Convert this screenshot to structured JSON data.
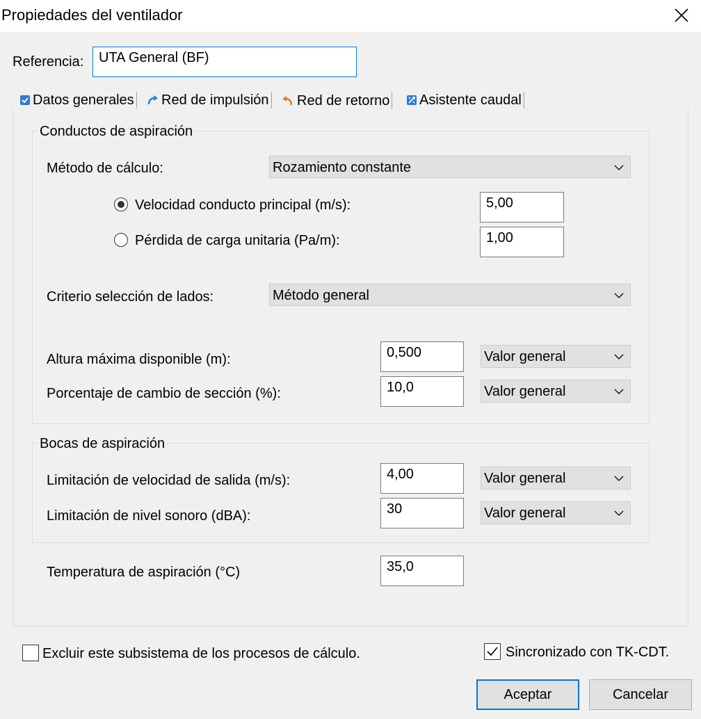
{
  "window": {
    "title": "Propiedades del ventilador",
    "close_icon": "close-icon"
  },
  "reference": {
    "label": "Referencia:",
    "value": "UTA General (BF)"
  },
  "tabs": [
    {
      "label": "Datos generales",
      "icon": "checkbox-icon"
    },
    {
      "label": "Red de impulsión",
      "icon": "arrow-forward-icon"
    },
    {
      "label": "Red de retorno",
      "icon": "arrow-return-icon"
    },
    {
      "label": "Asistente caudal",
      "icon": "wizard-icon"
    }
  ],
  "conductos": {
    "title": "Conductos de aspiración",
    "method_label": "Método de cálculo:",
    "method_value": "Rozamiento constante",
    "velocity_label": "Velocidad conducto principal (m/s):",
    "velocity_value": "5,00",
    "loss_label": "Pérdida de carga unitaria (Pa/m):",
    "loss_value": "1,00",
    "criterio_label": "Criterio selección de lados:",
    "criterio_value": "Método general",
    "altura_label": "Altura máxima disponible (m):",
    "altura_value": "0,500",
    "altura_mode": "Valor general",
    "porcentaje_label": "Porcentaje de cambio de sección (%):",
    "porcentaje_value": "10,0",
    "porcentaje_mode": "Valor general"
  },
  "bocas": {
    "title": "Bocas de aspiración",
    "velocidad_label": "Limitación de velocidad de salida (m/s):",
    "velocidad_value": "4,00",
    "velocidad_mode": "Valor general",
    "nivel_label": "Limitación de nivel sonoro (dBA):",
    "nivel_value": "30",
    "nivel_mode": "Valor general"
  },
  "temperatura": {
    "label": "Temperatura de aspiración (°C)",
    "value": "35,0"
  },
  "footer": {
    "excluir_label": "Excluir este subsistema de los procesos de cálculo.",
    "excluir_checked": false,
    "sincronizado_label": "Sincronizado con TK-CDT.",
    "sincronizado_checked": true,
    "accept_label": "Aceptar",
    "cancel_label": "Cancelar"
  },
  "colors": {
    "accent": "#0078d7",
    "panel": "#f0f0f0",
    "combo": "#e1e1e1"
  }
}
